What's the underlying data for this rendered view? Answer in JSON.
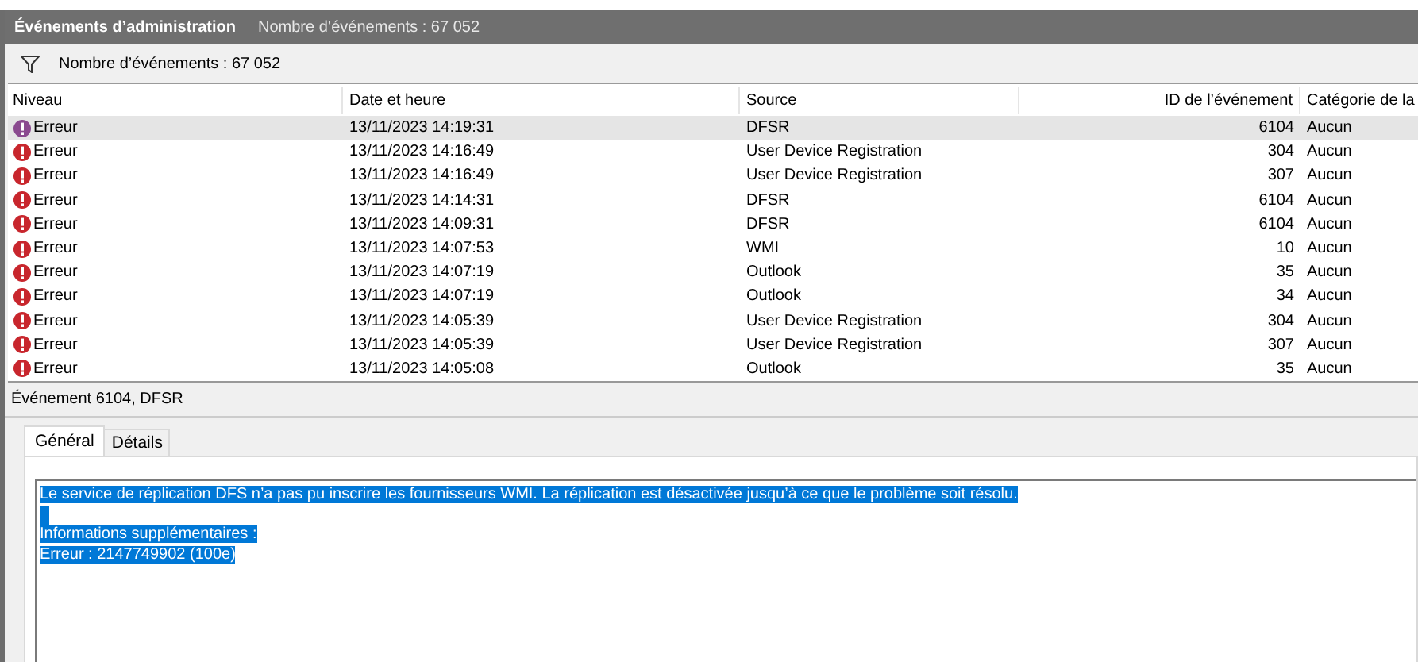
{
  "header": {
    "title": "Événements d’administration",
    "count": "Nombre d’événements : 67 052"
  },
  "filter_bar": {
    "text": "Nombre d’événements : 67 052"
  },
  "table": {
    "columns": [
      "Niveau",
      "Date et heure",
      "Source",
      "ID de l’événement",
      "Catégorie de la"
    ],
    "rows": [
      {
        "level": "Erreur",
        "date": "13/11/2023 14:19:31",
        "source": "DFSR",
        "id": "6104",
        "category": "Aucun",
        "selected": true
      },
      {
        "level": "Erreur",
        "date": "13/11/2023 14:16:49",
        "source": "User Device Registration",
        "id": "304",
        "category": "Aucun",
        "selected": false
      },
      {
        "level": "Erreur",
        "date": "13/11/2023 14:16:49",
        "source": "User Device Registration",
        "id": "307",
        "category": "Aucun",
        "selected": false
      },
      {
        "level": "Erreur",
        "date": "13/11/2023 14:14:31",
        "source": "DFSR",
        "id": "6104",
        "category": "Aucun",
        "selected": false
      },
      {
        "level": "Erreur",
        "date": "13/11/2023 14:09:31",
        "source": "DFSR",
        "id": "6104",
        "category": "Aucun",
        "selected": false
      },
      {
        "level": "Erreur",
        "date": "13/11/2023 14:07:53",
        "source": "WMI",
        "id": "10",
        "category": "Aucun",
        "selected": false
      },
      {
        "level": "Erreur",
        "date": "13/11/2023 14:07:19",
        "source": "Outlook",
        "id": "35",
        "category": "Aucun",
        "selected": false
      },
      {
        "level": "Erreur",
        "date": "13/11/2023 14:07:19",
        "source": "Outlook",
        "id": "34",
        "category": "Aucun",
        "selected": false
      },
      {
        "level": "Erreur",
        "date": "13/11/2023 14:05:39",
        "source": "User Device Registration",
        "id": "304",
        "category": "Aucun",
        "selected": false
      },
      {
        "level": "Erreur",
        "date": "13/11/2023 14:05:39",
        "source": "User Device Registration",
        "id": "307",
        "category": "Aucun",
        "selected": false
      },
      {
        "level": "Erreur",
        "date": "13/11/2023 14:05:08",
        "source": "Outlook",
        "id": "35",
        "category": "Aucun",
        "selected": false
      }
    ]
  },
  "detail": {
    "title": "Événement 6104, DFSR",
    "tabs": [
      {
        "label": "Général",
        "selected": true
      },
      {
        "label": "Détails",
        "selected": false
      }
    ],
    "description": {
      "selected": true,
      "lines": [
        {
          "kind": "text",
          "text": "Le service de réplication DFS n’a pas pu inscrire les fournisseurs WMI. La réplication est désactivée jusqu’à ce que le problème soit résolu."
        },
        {
          "kind": "blank"
        },
        {
          "kind": "text",
          "text": "Informations supplémentaires :"
        },
        {
          "kind": "text",
          "text": "Erreur : 2147749902 (100e)"
        }
      ]
    }
  }
}
